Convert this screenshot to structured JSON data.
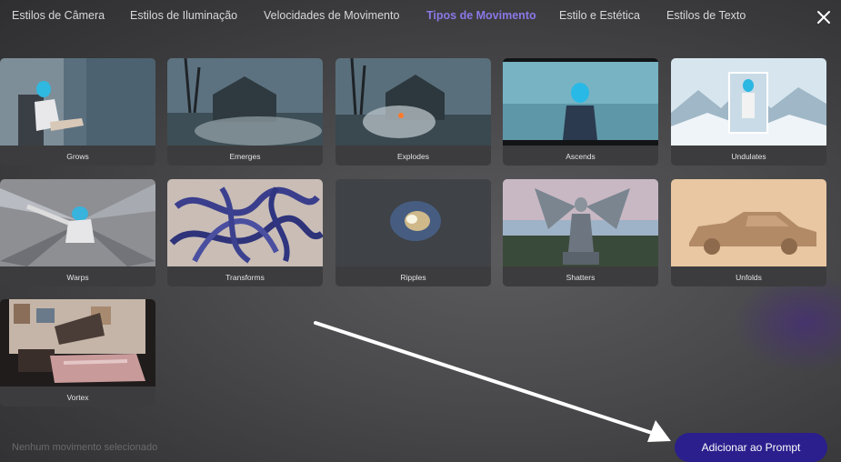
{
  "tabs": [
    {
      "label": "Estilos de Câmera"
    },
    {
      "label": "Estilos de Iluminação"
    },
    {
      "label": "Velocidades de Movimento"
    },
    {
      "label": "Tipos de Movimento"
    },
    {
      "label": "Estilo e Estética"
    },
    {
      "label": "Estilos de Texto"
    }
  ],
  "active_tab": "Tipos de Movimento",
  "close_icon": "close-icon",
  "cards": [
    {
      "label": "Grows"
    },
    {
      "label": "Emerges"
    },
    {
      "label": "Explodes"
    },
    {
      "label": "Ascends"
    },
    {
      "label": "Undulates"
    },
    {
      "label": "Warps"
    },
    {
      "label": "Transforms"
    },
    {
      "label": "Ripples"
    },
    {
      "label": "Shatters"
    },
    {
      "label": "Unfolds"
    },
    {
      "label": "Vortex"
    }
  ],
  "footer": {
    "status": "Nenhum movimento selecionado",
    "add_button": "Adicionar ao Prompt"
  },
  "colors": {
    "accent": "#8a78e6",
    "button": "#2a1f8c"
  }
}
